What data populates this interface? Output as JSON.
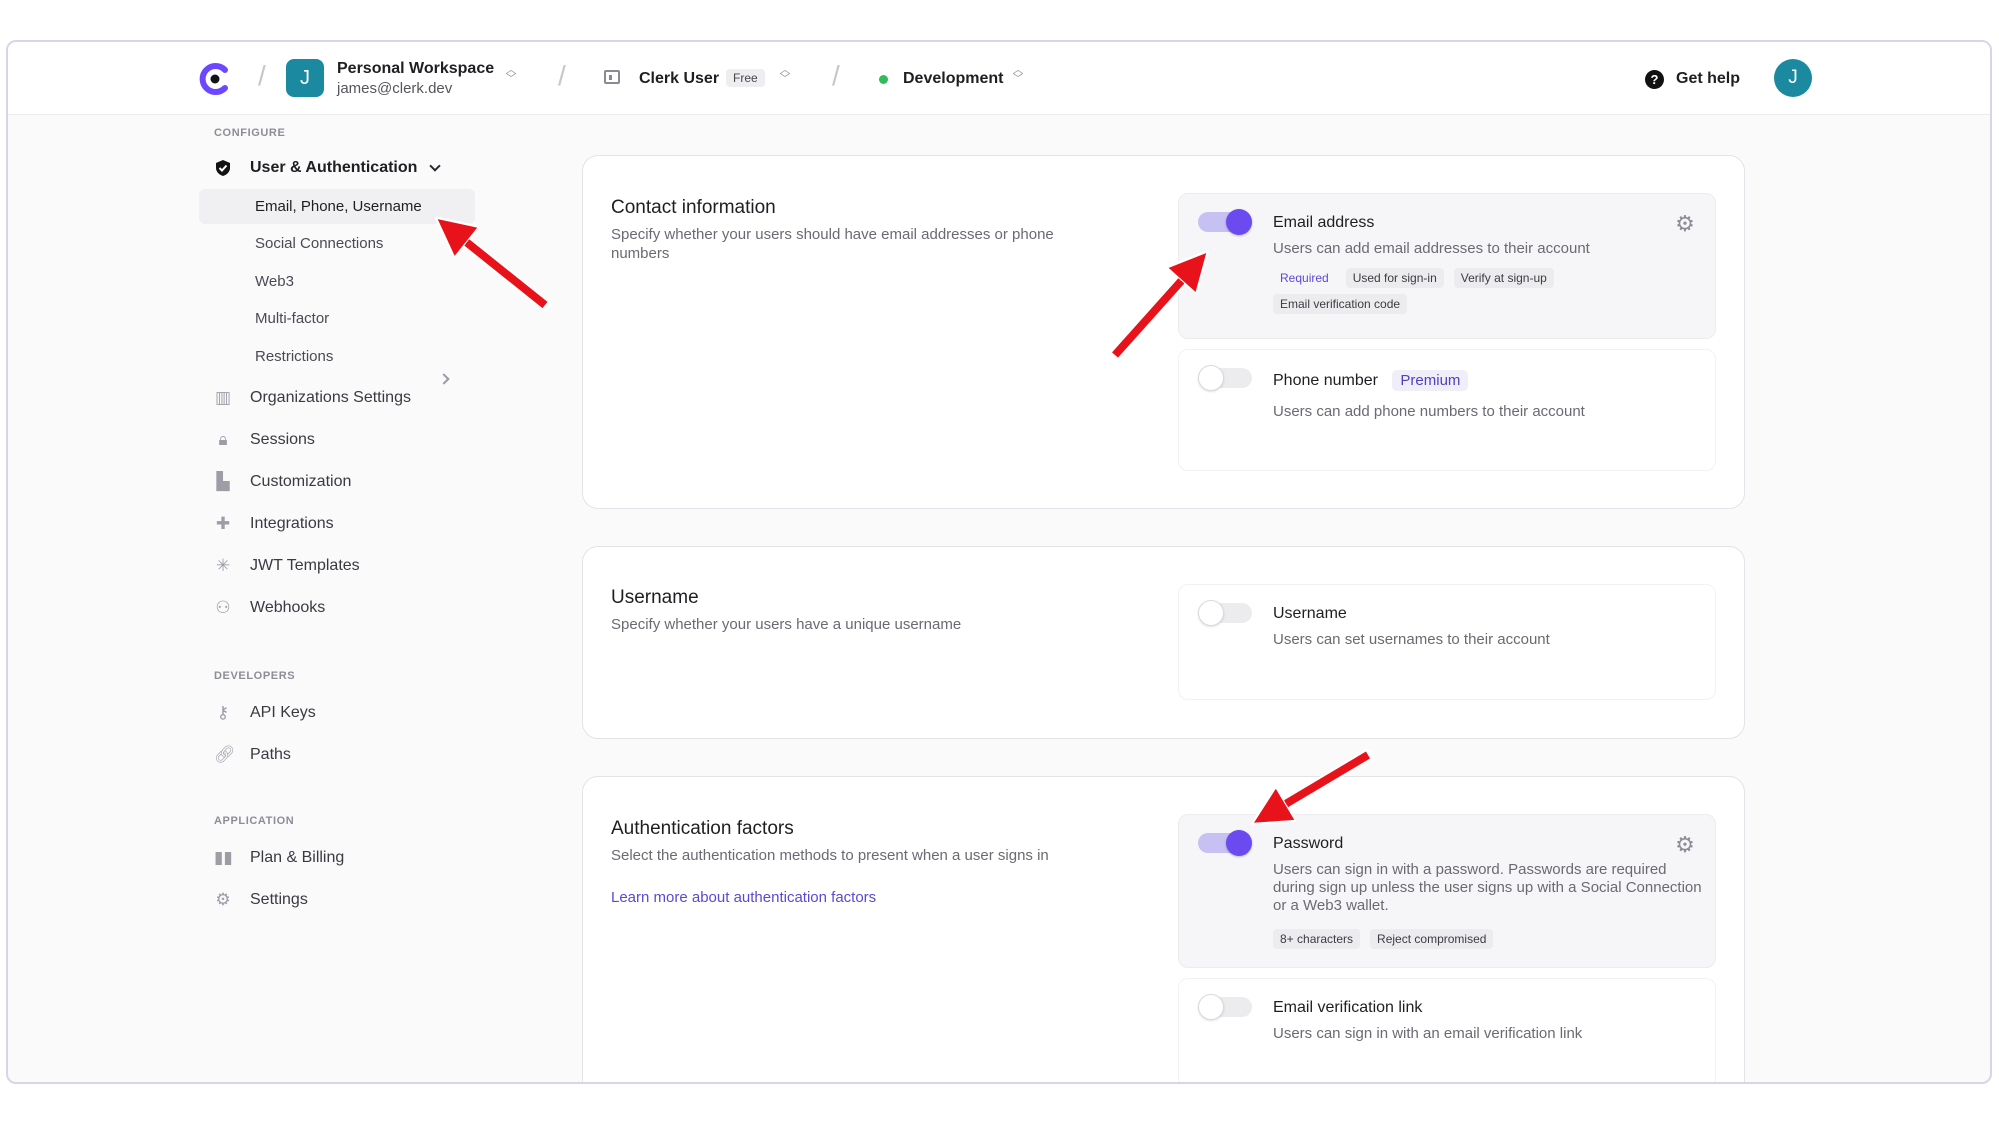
{
  "header": {
    "workspace_initial": "J",
    "workspace_name": "Personal Workspace",
    "workspace_email": "james@clerk.dev",
    "app_name": "Clerk User",
    "plan_badge": "Free",
    "environment": "Development",
    "help_label": "Get help",
    "user_initial": "J"
  },
  "sidebar": {
    "configure_label": "CONFIGURE",
    "user_auth": "User & Authentication",
    "sub_items": [
      "Email, Phone, Username",
      "Social Connections",
      "Web3",
      "Multi-factor",
      "Restrictions"
    ],
    "items": [
      {
        "label": "Organizations Settings",
        "icon": "building-icon"
      },
      {
        "label": "Sessions",
        "icon": "lock-icon"
      },
      {
        "label": "Customization",
        "icon": "brush-icon"
      },
      {
        "label": "Integrations",
        "icon": "puzzle-icon"
      },
      {
        "label": "JWT Templates",
        "icon": "jwt-icon"
      },
      {
        "label": "Webhooks",
        "icon": "webhook-icon"
      }
    ],
    "developers_label": "DEVELOPERS",
    "dev_items": [
      {
        "label": "API Keys",
        "icon": "key-icon"
      },
      {
        "label": "Paths",
        "icon": "link-icon"
      }
    ],
    "application_label": "APPLICATION",
    "app_items": [
      {
        "label": "Plan & Billing",
        "icon": "billing-icon"
      },
      {
        "label": "Settings",
        "icon": "gear-icon"
      }
    ]
  },
  "contact": {
    "title": "Contact information",
    "desc": "Specify whether your users should have email addresses or phone numbers",
    "email": {
      "title": "Email address",
      "desc": "Users can add email addresses to their account",
      "chips": [
        "Required",
        "Used for sign-in",
        "Verify at sign-up",
        "Email verification code"
      ],
      "enabled": true
    },
    "phone": {
      "title": "Phone number",
      "badge": "Premium",
      "desc": "Users can add phone numbers to their account",
      "enabled": false
    }
  },
  "username": {
    "title": "Username",
    "desc": "Specify whether your users have a unique username",
    "option": {
      "title": "Username",
      "desc": "Users can set usernames to their account",
      "enabled": false
    }
  },
  "auth": {
    "title": "Authentication factors",
    "desc": "Select the authentication methods to present when a user signs in",
    "link": "Learn more about authentication factors",
    "password": {
      "title": "Password",
      "desc": "Users can sign in with a password. Passwords are required during sign up unless the user signs up with a Social Connection or a Web3 wallet.",
      "chips": [
        "8+ characters",
        "Reject compromised"
      ],
      "enabled": true
    },
    "email_link": {
      "title": "Email verification link",
      "desc": "Users can sign in with an email verification link",
      "enabled": false
    }
  },
  "colors": {
    "accent": "#6b4bf0",
    "arrow": "#e8121a"
  }
}
